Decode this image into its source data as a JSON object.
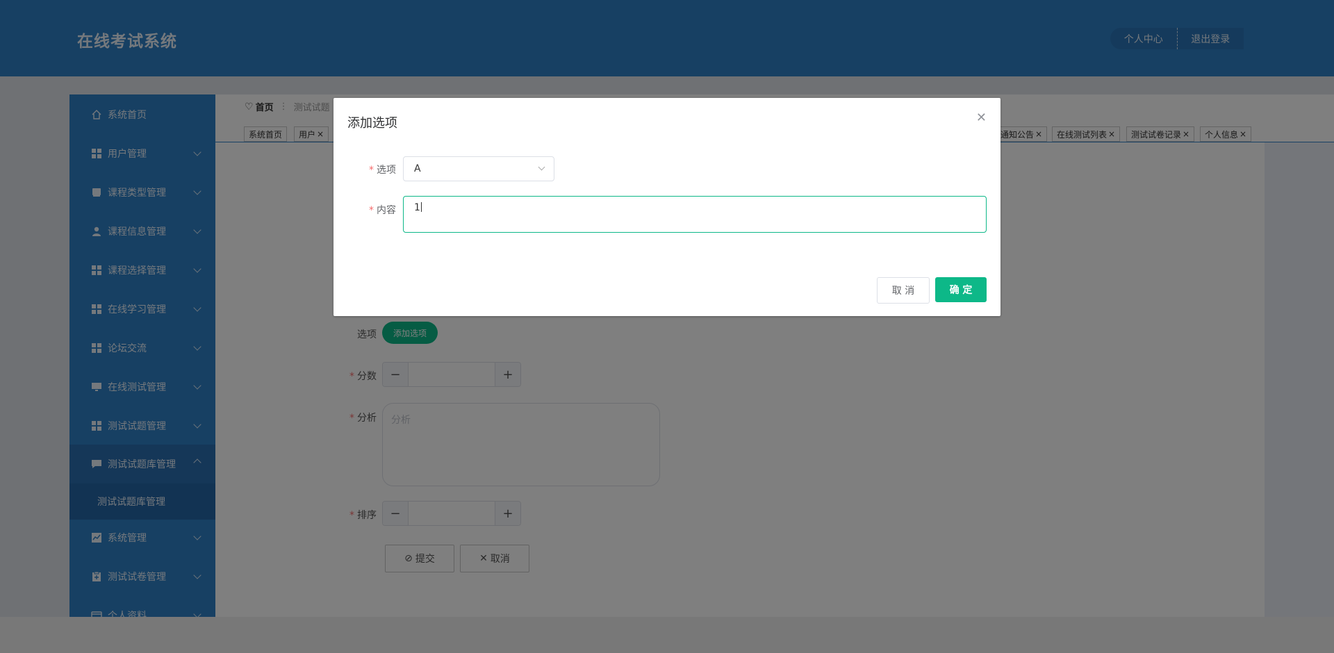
{
  "app": {
    "title": "在线考试系统"
  },
  "header": {
    "personal_center": "个人中心",
    "logout": "退出登录"
  },
  "sidebar": {
    "items": [
      {
        "label": "系统首页",
        "icon": "home-icon"
      },
      {
        "label": "用户管理",
        "icon": "grid-icon"
      },
      {
        "label": "课程类型管理",
        "icon": "book-icon"
      },
      {
        "label": "课程信息管理",
        "icon": "user-icon"
      },
      {
        "label": "课程选择管理",
        "icon": "grid-icon"
      },
      {
        "label": "在线学习管理",
        "icon": "grid-icon"
      },
      {
        "label": "论坛交流",
        "icon": "grid-icon"
      },
      {
        "label": "在线测试管理",
        "icon": "monitor-icon"
      },
      {
        "label": "测试试题管理",
        "icon": "grid-icon"
      },
      {
        "label": "测试试题库管理",
        "icon": "chat-icon"
      },
      {
        "label": "系统管理",
        "icon": "chart-icon"
      },
      {
        "label": "测试试卷管理",
        "icon": "clipboard-icon"
      },
      {
        "label": "个人资料",
        "icon": "card-icon"
      }
    ],
    "submenu_active": "测试试题库管理"
  },
  "breadcrumb": {
    "home": "首页",
    "current": "测试试题"
  },
  "tabs": [
    "系统首页",
    "用户",
    "通知公告",
    "在线测试列表",
    "测试试卷记录",
    "个人信息"
  ],
  "form": {
    "options_label": "选项",
    "add_option_button": "添加选项",
    "score_label": "分数",
    "analysis_label": "分析",
    "analysis_placeholder": "分析",
    "sort_label": "排序",
    "submit_button": "提交",
    "cancel_button": "取消",
    "minus": "−",
    "plus": "+"
  },
  "dialog": {
    "title": "添加选项",
    "option_label": "选项",
    "option_value": "A",
    "content_label": "内容",
    "content_value": "1",
    "cancel_button": "取 消",
    "confirm_button": "确 定"
  },
  "colors": {
    "primary": "#2f80c6",
    "accent": "#0db888",
    "required": "#f56c6c"
  }
}
